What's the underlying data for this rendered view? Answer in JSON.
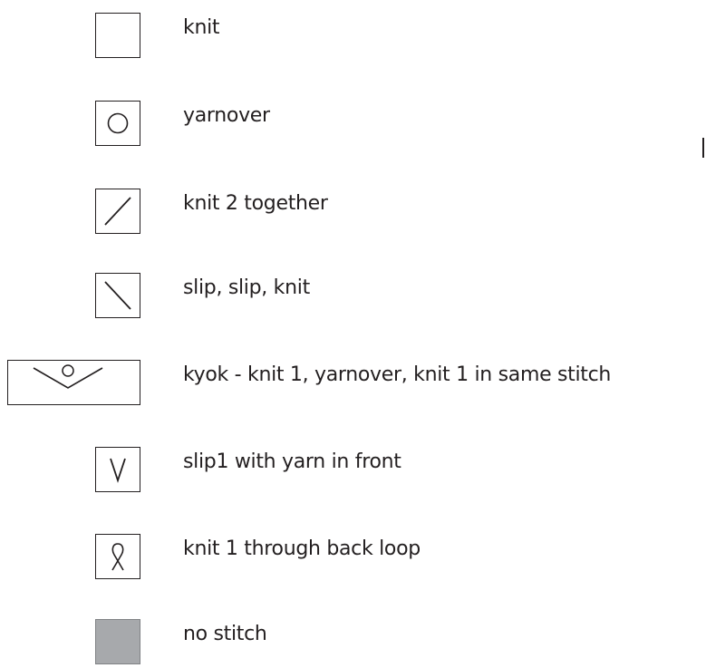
{
  "legend": {
    "items": [
      {
        "symbol": "empty-square-icon",
        "label": "knit"
      },
      {
        "symbol": "circle-in-square-icon",
        "label": "yarnover"
      },
      {
        "symbol": "forward-slash-icon",
        "label": "knit 2 together"
      },
      {
        "symbol": "back-slash-icon",
        "label": "slip, slip, knit"
      },
      {
        "symbol": "kyok-v-circle-icon",
        "label": "kyok - knit 1, yarnover, knit 1 in same stitch"
      },
      {
        "symbol": "v-letter-icon",
        "label": "slip1 with yarn in front"
      },
      {
        "symbol": "twisted-loop-icon",
        "label": "knit 1 through back loop"
      },
      {
        "symbol": "gray-square-icon",
        "label": "no stitch"
      }
    ]
  },
  "colors": {
    "stroke": "#231f20",
    "no_stitch_fill": "#a7a9ac",
    "background": "#ffffff"
  }
}
